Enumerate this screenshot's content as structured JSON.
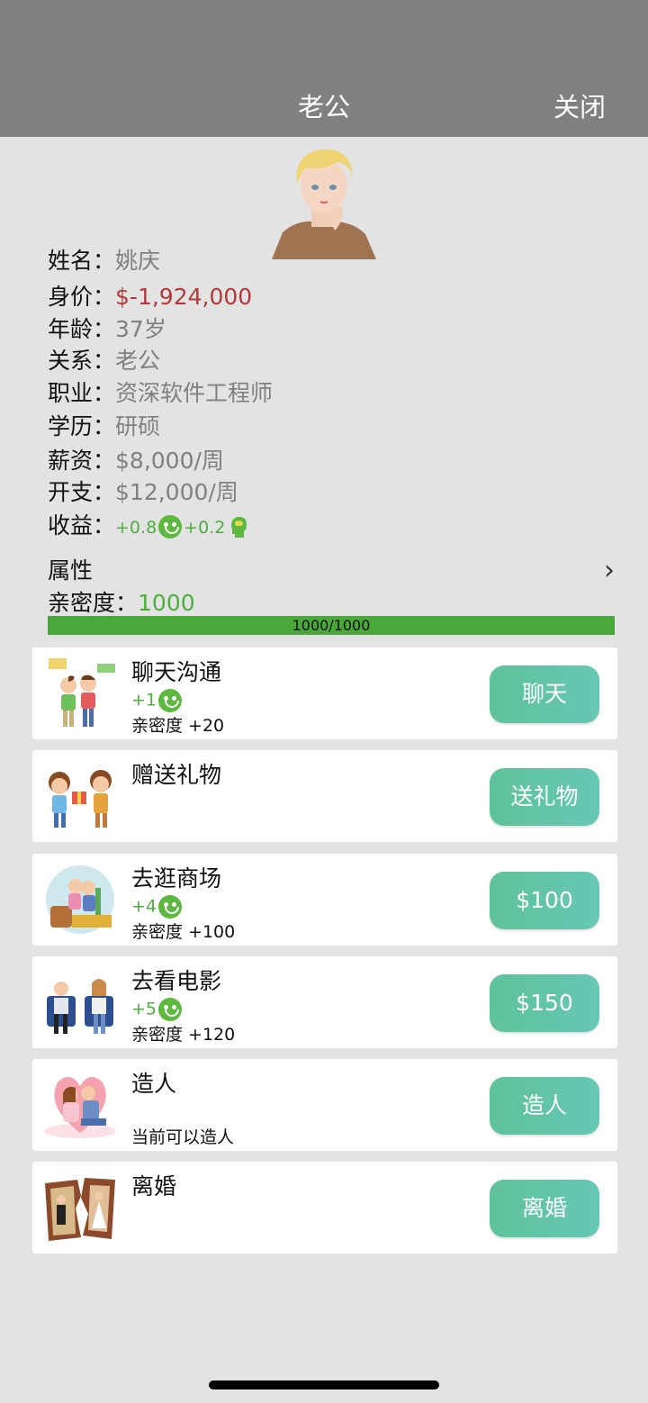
{
  "header": {
    "title": "老公",
    "close_label": "关闭"
  },
  "profile": {
    "rows": [
      {
        "label": "姓名：",
        "value": "姚庆"
      },
      {
        "label": "身价：",
        "value": "$-1,924,000"
      },
      {
        "label": "年龄：",
        "value": "37岁"
      },
      {
        "label": "关系：",
        "value": "老公"
      },
      {
        "label": "职业：",
        "value": "资深软件工程师"
      },
      {
        "label": "学历：",
        "value": "研硕"
      },
      {
        "label": "薪资：",
        "value": "$8,000/周"
      },
      {
        "label": "开支：",
        "value": "$12,000/周"
      }
    ],
    "income_label": "收益：",
    "income_happiness": "+0.8",
    "income_smart": "+0.2"
  },
  "attributes": {
    "label": "属性"
  },
  "intimacy": {
    "label": "亲密度：",
    "value": "1000",
    "progress_text": "1000/1000",
    "progress": 1.0
  },
  "actions": [
    {
      "name": "聊天沟通",
      "bonus": "+1",
      "sub": "亲密度 +20",
      "button": "聊天"
    },
    {
      "name": "赠送礼物",
      "bonus": "",
      "sub": "",
      "button": "送礼物"
    },
    {
      "name": "去逛商场",
      "bonus": "+4",
      "sub": "亲密度 +100",
      "button": "$100"
    },
    {
      "name": "去看电影",
      "bonus": "+5",
      "sub": "亲密度 +120",
      "button": "$150"
    },
    {
      "name": "造人",
      "bonus": "",
      "sub": "当前可以造人",
      "button": "造人"
    },
    {
      "name": "离婚",
      "bonus": "",
      "sub": "",
      "button": "离婚"
    }
  ],
  "colors": {
    "header": "#808080",
    "button": "#60c4a6",
    "green": "#4caf3c",
    "red": "#b13a3a"
  }
}
